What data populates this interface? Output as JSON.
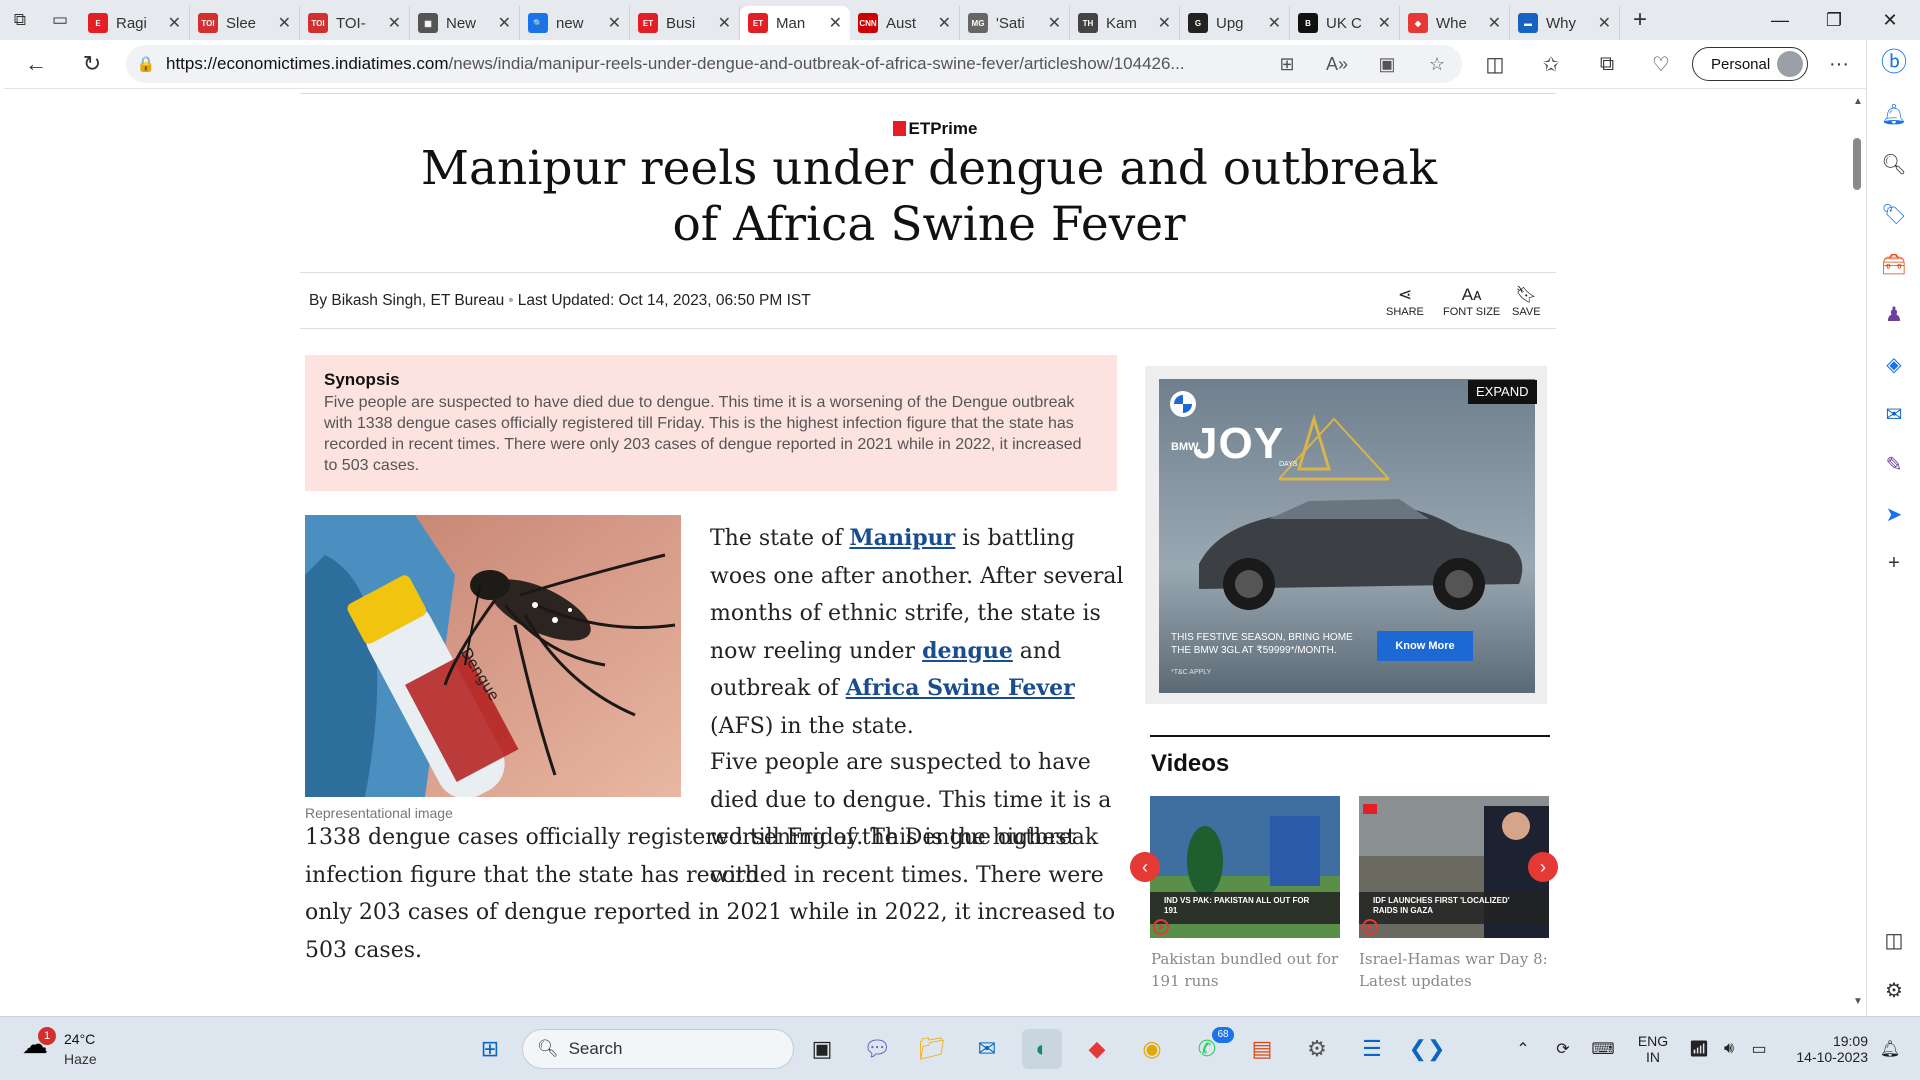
{
  "browser": {
    "tabs": [
      {
        "title": "Ragi",
        "fav": "E",
        "color": "#e31e24"
      },
      {
        "title": "Slee",
        "fav": "TOI",
        "color": "#d32f2f"
      },
      {
        "title": "TOI-",
        "fav": "TOI",
        "color": "#d32f2f"
      },
      {
        "title": "New",
        "fav": "▦",
        "color": "#555555"
      },
      {
        "title": "new",
        "fav": "🔍",
        "color": "#1a73e8"
      },
      {
        "title": "Busi",
        "fav": "ET",
        "color": "#e31e24"
      },
      {
        "title": "Man",
        "fav": "ET",
        "color": "#e31e24",
        "active": true
      },
      {
        "title": "Aust",
        "fav": "CNN",
        "color": "#cc0000"
      },
      {
        "title": "'Sati",
        "fav": "MG",
        "color": "#666666"
      },
      {
        "title": "Kam",
        "fav": "TH",
        "color": "#444444"
      },
      {
        "title": "Upg",
        "fav": "G",
        "color": "#222222"
      },
      {
        "title": "UK C",
        "fav": "B",
        "color": "#111111"
      },
      {
        "title": "Whe",
        "fav": "◆",
        "color": "#e53935"
      },
      {
        "title": "Why",
        "fav": "▬",
        "color": "#1565c0"
      }
    ],
    "url_domain": "https://economictimes.indiatimes.com",
    "url_path": "/news/india/manipur-reels-under-dengue-and-outbreak-of-africa-swine-fever/articleshow/104426...",
    "profile_label": "Personal"
  },
  "article": {
    "brand": "ETPrime",
    "headline": "Manipur reels under dengue and outbreak of Africa Swine Fever",
    "author": "By Bikash Singh, ET Bureau",
    "updated": "Last Updated: Oct 14, 2023, 06:50 PM IST",
    "tools": {
      "share": "SHARE",
      "font_size": "FONT SIZE",
      "save": "SAVE"
    },
    "synopsis_title": "Synopsis",
    "synopsis_text": "Five people are suspected to have died due to dengue. This time it is a worsening of the Dengue outbreak with 1338 dengue cases officially registered till Friday. This is the highest infection figure that the state has recorded in recent times. There were only 203 cases of dengue reported in 2021 while in 2022, it increased to 503 cases.",
    "image_caption": "Representational image",
    "image_label": "Dengue",
    "p1_a": "The state of ",
    "p1_link1": "Manipur",
    "p1_b": " is battling woes one after another. After several months of ethnic strife, the state is now reeling under ",
    "p1_link2": "dengue",
    "p1_c": " and outbreak of ",
    "p1_link3": "Africa Swine Fever",
    "p1_d": " (AFS) in the state.",
    "p2_wrap": "Five people are suspected to have died due to dengue. This time it is a worsening of the Dengue outbreak with",
    "p2_full": "1338 dengue cases officially registered till Friday. This is the highest infection figure that the state has recorded in recent times. There were only 203 cases of dengue reported in 2021 while in 2022, it increased to 503 cases."
  },
  "sidebar": {
    "ad_expand": "EXPAND",
    "ad_brand": "BMW",
    "ad_joy": "JOY",
    "ad_days": "DAYS",
    "ad_line1": "THIS FESTIVE SEASON, BRING HOME",
    "ad_line2": "THE BMW 3GL AT ₹59999*/MONTH.",
    "ad_tc": "*T&C APPLY",
    "ad_cta": "Know More",
    "videos_heading": "Videos",
    "videos": [
      {
        "overlay": "IND VS PAK: PAKISTAN ALL OUT FOR 191",
        "title": "Pakistan bundled out for 191 runs"
      },
      {
        "overlay": "IDF LAUNCHES FIRST 'LOCALIZED' RAIDS IN GAZA",
        "title": "Israel-Hamas war Day 8: Latest updates"
      }
    ]
  },
  "taskbar": {
    "weather_temp": "24°C",
    "weather_desc": "Haze",
    "weather_badge": "1",
    "search_label": "Search",
    "whatsapp_badge": "68",
    "lang_line1": "ENG",
    "lang_line2": "IN",
    "time": "19:09",
    "date": "14-10-2023"
  }
}
